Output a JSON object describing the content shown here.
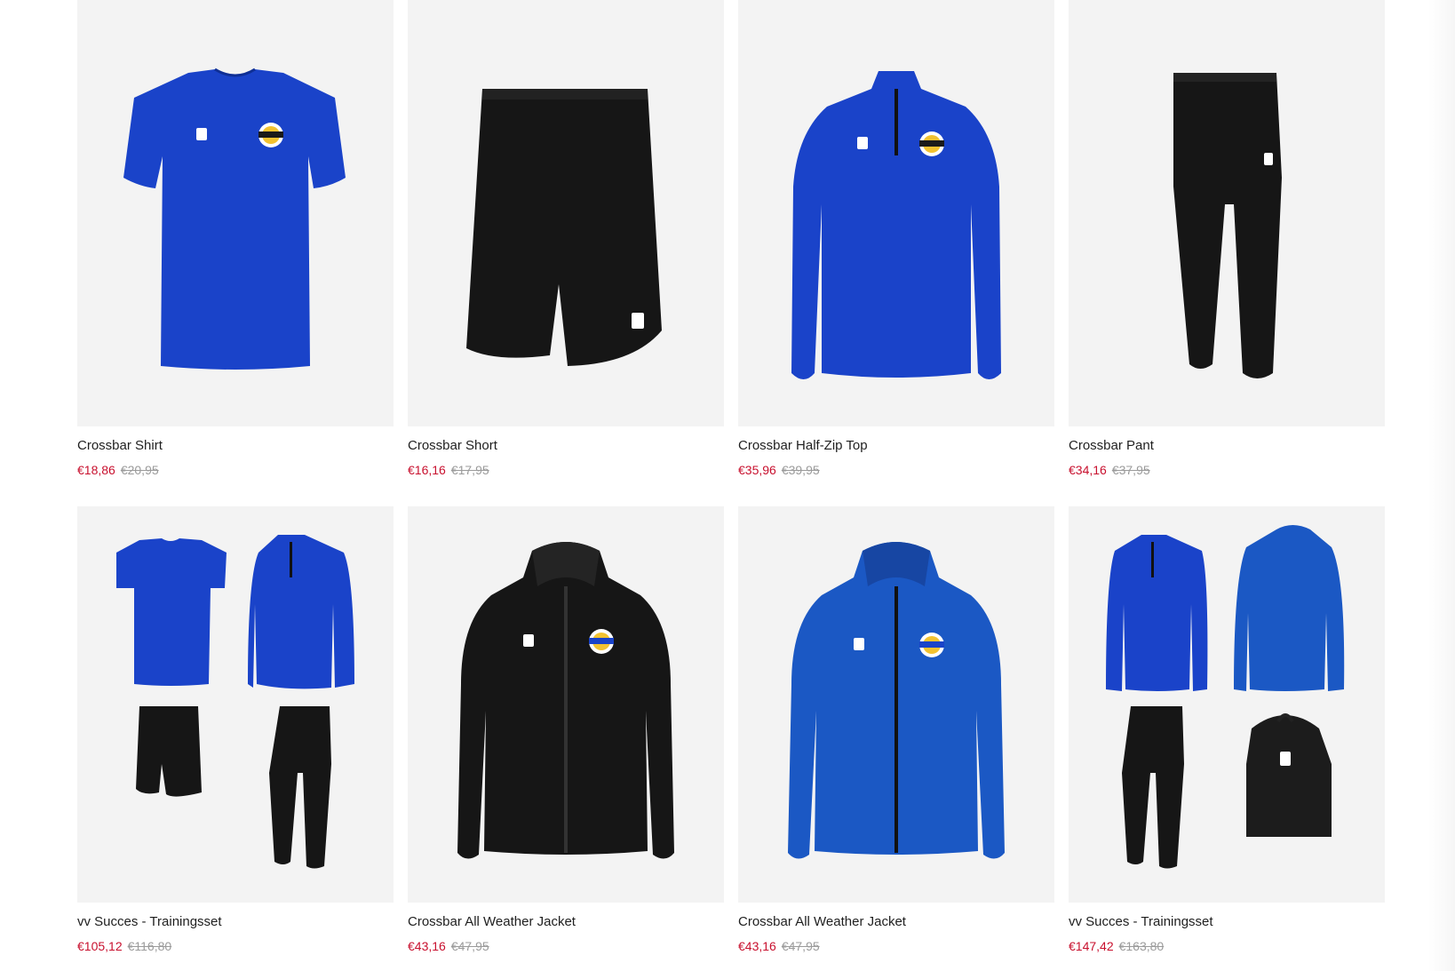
{
  "products": [
    {
      "name": "Crossbar Shirt",
      "price": "€18,86",
      "old_price": "€20,95",
      "image_icon": "blue-shirt-icon"
    },
    {
      "name": "Crossbar Short",
      "price": "€16,16",
      "old_price": "€17,95",
      "image_icon": "black-shorts-icon"
    },
    {
      "name": "Crossbar Half-Zip Top",
      "price": "€35,96",
      "old_price": "€39,95",
      "image_icon": "blue-half-zip-icon"
    },
    {
      "name": "Crossbar Pant",
      "price": "€34,16",
      "old_price": "€37,95",
      "image_icon": "black-pant-icon"
    },
    {
      "name": "vv Succes - Trainingsset",
      "price": "€105,12",
      "old_price": "€116,80",
      "image_icon": "training-set-icon"
    },
    {
      "name": "Crossbar All Weather Jacket",
      "price": "€43,16",
      "old_price": "€47,95",
      "image_icon": "black-jacket-icon"
    },
    {
      "name": "Crossbar All Weather Jacket",
      "price": "€43,16",
      "old_price": "€47,95",
      "image_icon": "blue-jacket-icon"
    },
    {
      "name": "vv Succes - Trainingsset",
      "price": "€147,42",
      "old_price": "€163,80",
      "image_icon": "training-set-backpack-icon"
    }
  ],
  "colors": {
    "sale_price": "#c8102e",
    "old_price": "#9b9b9b",
    "image_bg": "#f3f3f3",
    "royal_blue": "#1a43c9",
    "black_garment": "#161616"
  }
}
